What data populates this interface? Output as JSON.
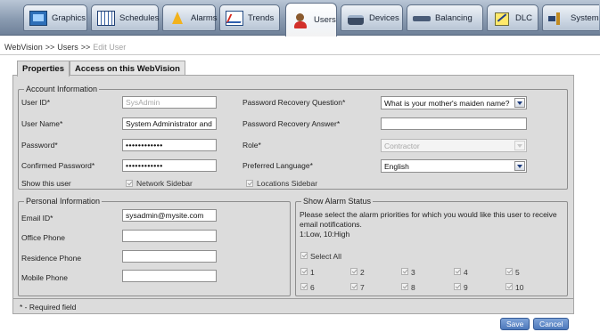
{
  "nav": {
    "tabs": [
      {
        "label": "Graphics",
        "icon": "graphics-icon"
      },
      {
        "label": "Schedules",
        "icon": "schedules-icon"
      },
      {
        "label": "Alarms",
        "icon": "alarms-icon"
      },
      {
        "label": "Trends",
        "icon": "trends-icon"
      },
      {
        "label": "Users",
        "icon": "users-icon",
        "active": true
      },
      {
        "label": "Devices",
        "icon": "devices-icon"
      },
      {
        "label": "Balancing",
        "icon": "balancing-icon"
      },
      {
        "label": "DLC",
        "icon": "dlc-icon"
      },
      {
        "label": "System",
        "icon": "system-icon"
      }
    ]
  },
  "breadcrumb": {
    "root": "WebVision",
    "sep1": ">>",
    "section": "Users",
    "sep2": ">>",
    "current": "Edit User"
  },
  "subtabs": {
    "properties": "Properties",
    "access": "Access on this WebVision"
  },
  "account": {
    "legend": "Account Information",
    "user_id_label": "User ID*",
    "user_id_value": "SysAdmin",
    "user_name_label": "User Name*",
    "user_name_value": "System Administrator and",
    "password_label": "Password*",
    "password_value": "••••••••••••",
    "confirm_label": "Confirmed Password*",
    "confirm_value": "••••••••••••",
    "show_user_label": "Show this user",
    "network_sidebar": "Network Sidebar",
    "locations_sidebar": "Locations Sidebar",
    "recovery_question_label": "Password Recovery Question*",
    "recovery_question_value": "What is your mother's maiden name?",
    "recovery_answer_label": "Password Recovery Answer*",
    "recovery_answer_value": "",
    "role_label": "Role*",
    "role_value": "Contractor",
    "language_label": "Preferred Language*",
    "language_value": "English"
  },
  "personal": {
    "legend": "Personal Information",
    "email_label": "Email ID*",
    "email_value": "sysadmin@mysite.com",
    "office_label": "Office Phone",
    "office_value": "",
    "residence_label": "Residence Phone",
    "residence_value": "",
    "mobile_label": "Mobile Phone",
    "mobile_value": ""
  },
  "alarm": {
    "legend": "Show Alarm Status",
    "description": "Please select the alarm priorities for which you would like this user to receive email notifications.",
    "range_note": "1:Low, 10:High",
    "select_all": "Select All",
    "priorities": [
      "1",
      "2",
      "3",
      "4",
      "5",
      "6",
      "7",
      "8",
      "9",
      "10"
    ]
  },
  "footer": {
    "required_note": "* - Required field",
    "save": "Save",
    "cancel": "Cancel"
  }
}
